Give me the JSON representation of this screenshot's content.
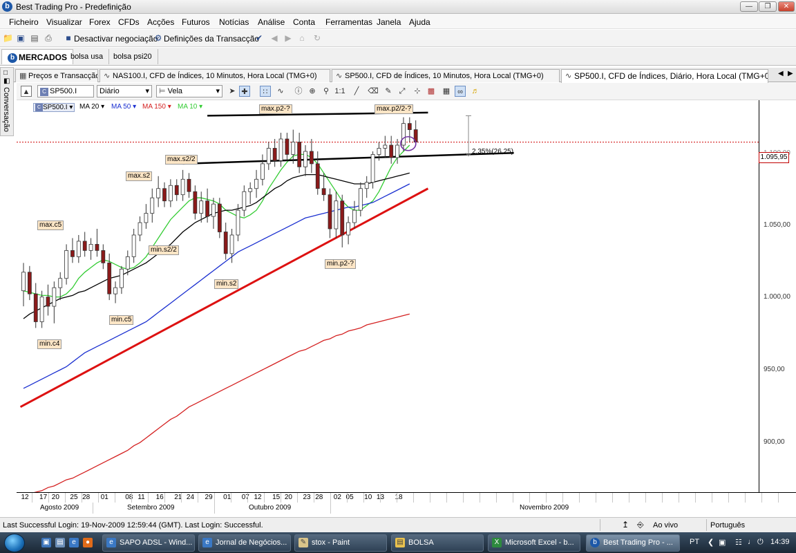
{
  "window": {
    "title": "Best Trading Pro - Predefinição"
  },
  "menu": [
    "Ficheiro",
    "Visualizar",
    "Forex",
    "CFDs",
    "Acções",
    "Futuros",
    "Notícias",
    "Análise",
    "Conta",
    "Ferramentas",
    "Janela",
    "Ajuda"
  ],
  "toolbar": {
    "deactivate_label": "Desactivar negociação",
    "settings_label": "Definições da Transacção"
  },
  "workspace_tabs": [
    "MERCADOS",
    "bolsa usa",
    "bolsa psi20"
  ],
  "side_panel": {
    "label": "Conversação"
  },
  "doc_tabs": [
    {
      "label": "Preços e Transacção"
    },
    {
      "label": "NAS100.I, CFD de Índices, 10 Minutos, Hora Local (TMG+0)"
    },
    {
      "label": "SP500.I, CFD de Índices, 10 Minutos, Hora Local (TMG+0)"
    },
    {
      "label": "SP500.I, CFD de Índices, Diário, Hora Local (TMG+0)"
    }
  ],
  "chart_toolbar": {
    "symbol": "SP500.I",
    "interval": "Diário",
    "style": "Vela"
  },
  "legend": {
    "symbol": "SP500.I",
    "ma": [
      {
        "label": "MA 20",
        "color": "#000000"
      },
      {
        "label": "MA 50",
        "color": "#1a2fd0"
      },
      {
        "label": "MA 150",
        "color": "#d42020"
      },
      {
        "label": "MA 10",
        "color": "#33cc33"
      }
    ]
  },
  "chart_data": {
    "type": "candlestick",
    "ylim": [
      870,
      1120
    ],
    "yticks": [
      "900,00",
      "950,00",
      "1.000,00",
      "1.050,00",
      "1.095,95"
    ],
    "yticks_partial": [
      "1.100,00"
    ],
    "last_price": "1.095,95",
    "x_day_labels": [
      "12",
      "17",
      "20",
      "25",
      "28",
      "01",
      "08",
      "11",
      "16",
      "21",
      "24",
      "29",
      "01",
      "07",
      "12",
      "15",
      "20",
      "23",
      "28",
      "02",
      "05",
      "10",
      "13",
      "18"
    ],
    "months": [
      "Agosto 2009",
      "Setembro 2009",
      "Outubro 2009",
      "Novembro 2009"
    ],
    "candles": [
      {
        "o": 1000,
        "h": 1018,
        "l": 990,
        "c": 1012
      },
      {
        "o": 1012,
        "h": 1016,
        "l": 994,
        "c": 998
      },
      {
        "o": 998,
        "h": 1005,
        "l": 976,
        "c": 980
      },
      {
        "o": 980,
        "h": 1000,
        "l": 976,
        "c": 996
      },
      {
        "o": 996,
        "h": 1004,
        "l": 984,
        "c": 990
      },
      {
        "o": 990,
        "h": 1006,
        "l": 979,
        "c": 1002
      },
      {
        "o": 1002,
        "h": 1012,
        "l": 994,
        "c": 1008
      },
      {
        "o": 1008,
        "h": 1030,
        "l": 1004,
        "c": 1026
      },
      {
        "o": 1026,
        "h": 1034,
        "l": 1018,
        "c": 1022
      },
      {
        "o": 1022,
        "h": 1036,
        "l": 1018,
        "c": 1032
      },
      {
        "o": 1032,
        "h": 1038,
        "l": 1022,
        "c": 1026
      },
      {
        "o": 1026,
        "h": 1034,
        "l": 1020,
        "c": 1030
      },
      {
        "o": 1030,
        "h": 1040,
        "l": 1022,
        "c": 1026
      },
      {
        "o": 1026,
        "h": 1030,
        "l": 1014,
        "c": 1018
      },
      {
        "o": 1018,
        "h": 1024,
        "l": 994,
        "c": 998
      },
      {
        "o": 998,
        "h": 1006,
        "l": 992,
        "c": 1002
      },
      {
        "o": 1002,
        "h": 1016,
        "l": 998,
        "c": 1014
      },
      {
        "o": 1014,
        "h": 1026,
        "l": 1010,
        "c": 1022
      },
      {
        "o": 1022,
        "h": 1040,
        "l": 1018,
        "c": 1036
      },
      {
        "o": 1036,
        "h": 1048,
        "l": 1032,
        "c": 1044
      },
      {
        "o": 1044,
        "h": 1056,
        "l": 1040,
        "c": 1050
      },
      {
        "o": 1050,
        "h": 1066,
        "l": 1044,
        "c": 1060
      },
      {
        "o": 1060,
        "h": 1074,
        "l": 1054,
        "c": 1066
      },
      {
        "o": 1066,
        "h": 1070,
        "l": 1054,
        "c": 1058
      },
      {
        "o": 1058,
        "h": 1072,
        "l": 1054,
        "c": 1068
      },
      {
        "o": 1068,
        "h": 1072,
        "l": 1058,
        "c": 1062
      },
      {
        "o": 1062,
        "h": 1078,
        "l": 1058,
        "c": 1072
      },
      {
        "o": 1072,
        "h": 1076,
        "l": 1060,
        "c": 1064
      },
      {
        "o": 1064,
        "h": 1068,
        "l": 1046,
        "c": 1050
      },
      {
        "o": 1050,
        "h": 1064,
        "l": 1044,
        "c": 1058
      },
      {
        "o": 1058,
        "h": 1066,
        "l": 1044,
        "c": 1048
      },
      {
        "o": 1048,
        "h": 1060,
        "l": 1040,
        "c": 1056
      },
      {
        "o": 1056,
        "h": 1060,
        "l": 1034,
        "c": 1038
      },
      {
        "o": 1038,
        "h": 1044,
        "l": 1020,
        "c": 1024
      },
      {
        "o": 1024,
        "h": 1040,
        "l": 1018,
        "c": 1036
      },
      {
        "o": 1036,
        "h": 1056,
        "l": 1032,
        "c": 1052
      },
      {
        "o": 1052,
        "h": 1068,
        "l": 1048,
        "c": 1064
      },
      {
        "o": 1064,
        "h": 1070,
        "l": 1056,
        "c": 1066
      },
      {
        "o": 1066,
        "h": 1078,
        "l": 1060,
        "c": 1072
      },
      {
        "o": 1072,
        "h": 1088,
        "l": 1068,
        "c": 1082
      },
      {
        "o": 1082,
        "h": 1096,
        "l": 1078,
        "c": 1092
      },
      {
        "o": 1092,
        "h": 1098,
        "l": 1080,
        "c": 1084
      },
      {
        "o": 1084,
        "h": 1102,
        "l": 1080,
        "c": 1098
      },
      {
        "o": 1098,
        "h": 1102,
        "l": 1084,
        "c": 1088
      },
      {
        "o": 1088,
        "h": 1104,
        "l": 1082,
        "c": 1096
      },
      {
        "o": 1096,
        "h": 1102,
        "l": 1076,
        "c": 1080
      },
      {
        "o": 1080,
        "h": 1094,
        "l": 1074,
        "c": 1090
      },
      {
        "o": 1090,
        "h": 1098,
        "l": 1076,
        "c": 1082
      },
      {
        "o": 1082,
        "h": 1090,
        "l": 1062,
        "c": 1066
      },
      {
        "o": 1066,
        "h": 1076,
        "l": 1058,
        "c": 1062
      },
      {
        "o": 1062,
        "h": 1066,
        "l": 1034,
        "c": 1040
      },
      {
        "o": 1040,
        "h": 1064,
        "l": 1034,
        "c": 1058
      },
      {
        "o": 1058,
        "h": 1062,
        "l": 1028,
        "c": 1036
      },
      {
        "o": 1036,
        "h": 1048,
        "l": 1030,
        "c": 1044
      },
      {
        "o": 1044,
        "h": 1058,
        "l": 1040,
        "c": 1052
      },
      {
        "o": 1052,
        "h": 1070,
        "l": 1048,
        "c": 1066
      },
      {
        "o": 1066,
        "h": 1074,
        "l": 1060,
        "c": 1070
      },
      {
        "o": 1070,
        "h": 1090,
        "l": 1066,
        "c": 1088
      },
      {
        "o": 1088,
        "h": 1096,
        "l": 1084,
        "c": 1092
      },
      {
        "o": 1092,
        "h": 1100,
        "l": 1086,
        "c": 1094
      },
      {
        "o": 1094,
        "h": 1100,
        "l": 1082,
        "c": 1086
      },
      {
        "o": 1086,
        "h": 1098,
        "l": 1082,
        "c": 1094
      },
      {
        "o": 1094,
        "h": 1112,
        "l": 1090,
        "c": 1108
      },
      {
        "o": 1108,
        "h": 1112,
        "l": 1096,
        "c": 1104
      },
      {
        "o": 1104,
        "h": 1110,
        "l": 1094,
        "c": 1096
      }
    ],
    "series": [
      {
        "name": "MA 10",
        "color": "#33cc33",
        "values": [
          1000,
          999,
          998,
          997,
          997,
          996,
          996,
          998,
          1002,
          1008,
          1012,
          1015,
          1018,
          1020,
          1019,
          1017,
          1015,
          1014,
          1015,
          1018,
          1022,
          1028,
          1034,
          1040,
          1046,
          1050,
          1054,
          1058,
          1060,
          1060,
          1059,
          1058,
          1056,
          1052,
          1050,
          1048,
          1047,
          1049,
          1052,
          1058,
          1066,
          1072,
          1078,
          1083,
          1087,
          1088,
          1088,
          1086,
          1082,
          1076,
          1070,
          1064,
          1058,
          1054,
          1052,
          1052,
          1055,
          1058,
          1064,
          1072,
          1080,
          1086,
          1090,
          1094
        ]
      },
      {
        "name": "MA 20",
        "color": "#000000",
        "values": [
          982,
          985,
          987,
          989,
          991,
          993,
          995,
          996,
          997,
          999,
          1000,
          1002,
          1004,
          1006,
          1008,
          1009,
          1010,
          1012,
          1014,
          1016,
          1018,
          1021,
          1024,
          1027,
          1030,
          1034,
          1038,
          1041,
          1044,
          1046,
          1048,
          1050,
          1051,
          1052,
          1052,
          1053,
          1054,
          1055,
          1057,
          1060,
          1063,
          1066,
          1068,
          1071,
          1073,
          1074,
          1075,
          1075,
          1075,
          1074,
          1073,
          1072,
          1071,
          1070,
          1069,
          1069,
          1069,
          1070,
          1071,
          1072,
          1073,
          1074,
          1075,
          1076
        ]
      },
      {
        "name": "MA 50",
        "color": "#1a2fd0",
        "values": [
          937,
          939,
          941,
          943,
          945,
          947,
          949,
          951,
          954,
          957,
          960,
          962,
          964,
          966,
          968,
          970,
          972,
          974,
          976,
          978,
          980,
          983,
          986,
          989,
          992,
          995,
          998,
          1001,
          1004,
          1007,
          1010,
          1013,
          1016,
          1019,
          1022,
          1025,
          1027,
          1029,
          1031,
          1033,
          1035,
          1037,
          1039,
          1041,
          1043,
          1045,
          1047,
          1048,
          1049,
          1050,
          1051,
          1052,
          1053,
          1054,
          1054,
          1055,
          1056,
          1057,
          1059,
          1061,
          1063,
          1065,
          1067,
          1069
        ]
      },
      {
        "name": "MA 150",
        "color": "#d42020",
        "values": [
          868,
          869,
          870,
          871,
          873,
          874,
          876,
          878,
          879,
          881,
          883,
          885,
          887,
          889,
          891,
          893,
          895,
          897,
          900,
          902,
          905,
          908,
          911,
          914,
          917,
          919,
          922,
          925,
          927,
          929,
          931,
          933,
          935,
          937,
          939,
          941,
          943,
          945,
          947,
          949,
          951,
          953,
          955,
          957,
          959,
          961,
          962,
          964,
          966,
          968,
          969,
          971,
          972,
          974,
          975,
          976,
          978,
          979,
          980,
          981,
          982,
          983,
          984,
          985
        ]
      }
    ],
    "annotations": [
      {
        "label": "max.p2-?"
      },
      {
        "label": "max.p2/2-?"
      },
      {
        "label": "max.s2/2"
      },
      {
        "label": "max.s2"
      },
      {
        "label": "max.c5"
      },
      {
        "label": "min.s2/2"
      },
      {
        "label": "min.s2"
      },
      {
        "label": "min.c5"
      },
      {
        "label": "min.c4"
      },
      {
        "label": "min.p2-?"
      }
    ],
    "measure_label": "2,35%(26,25)",
    "trendlines": [
      {
        "name": "resistance",
        "color": "#000000",
        "from": [
          30,
          1113
        ],
        "to": [
          66,
          1115
        ]
      },
      {
        "name": "support",
        "color": "#000000",
        "from": [
          26,
          1082
        ],
        "to": [
          80,
          1089
        ]
      },
      {
        "name": "uptrend",
        "color": "#dd1111",
        "from": [
          -0.5,
          925
        ],
        "to": [
          66,
          1066
        ]
      }
    ]
  },
  "status": {
    "login": "Last Successful Login: 19-Nov-2009 12:59:44 (GMT). Last Login: Successful.",
    "mode": "Ao vivo",
    "language": "Português"
  },
  "taskbar": {
    "items": [
      "SAPO ADSL - Wind...",
      "Jornal de Negócios...",
      "stox - Paint",
      "BOLSA",
      "Microsoft Excel - b...",
      "Best Trading Pro - ..."
    ],
    "lang": "PT",
    "clock": "14:39"
  }
}
